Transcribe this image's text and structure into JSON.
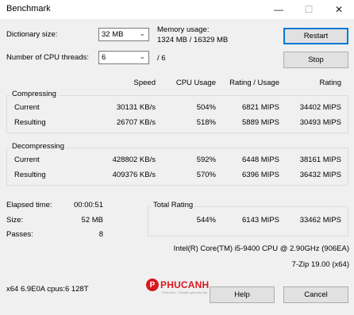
{
  "window": {
    "title": "Benchmark",
    "min": "—",
    "max": "☐",
    "close": "✕"
  },
  "dictionary": {
    "label": "Dictionary size:",
    "value": "32 MB"
  },
  "memory": {
    "label": "Memory usage:",
    "value": "1324 MB / 16329 MB"
  },
  "threads": {
    "label": "Number of CPU threads:",
    "value": "6",
    "max": "/ 6"
  },
  "buttons": {
    "restart": "Restart",
    "stop": "Stop",
    "help": "Help",
    "cancel": "Cancel"
  },
  "headers": {
    "speed": "Speed",
    "cpu_usage": "CPU Usage",
    "rating_usage": "Rating / Usage",
    "rating": "Rating"
  },
  "compressing": {
    "label": "Compressing",
    "current": {
      "label": "Current",
      "speed": "30131 KB/s",
      "cpu": "504%",
      "rating_usage": "6821 MIPS",
      "rating": "34402 MIPS"
    },
    "resulting": {
      "label": "Resulting",
      "speed": "26707 KB/s",
      "cpu": "518%",
      "rating_usage": "5889 MIPS",
      "rating": "30493 MIPS"
    }
  },
  "decompressing": {
    "label": "Decompressing",
    "current": {
      "label": "Current",
      "speed": "428802 KB/s",
      "cpu": "592%",
      "rating_usage": "6448 MIPS",
      "rating": "38161 MIPS"
    },
    "resulting": {
      "label": "Resulting",
      "speed": "409376 KB/s",
      "cpu": "570%",
      "rating_usage": "6396 MIPS",
      "rating": "36432 MIPS"
    }
  },
  "stats": {
    "elapsed_label": "Elapsed time:",
    "elapsed": "00:00:51",
    "size_label": "Size:",
    "size": "52 MB",
    "passes_label": "Passes:",
    "passes": "8"
  },
  "total": {
    "label": "Total Rating",
    "cpu": "544%",
    "rating_usage": "6143 MIPS",
    "rating": "33462 MIPS"
  },
  "cpu_info": "Intel(R) Core(TM) i5-9400 CPU @ 2.90GHz (906EA)",
  "version": "7-Zip 19.00 (x64)",
  "sys_info": "x64 6.9E0A cpus:6 128T",
  "watermark": {
    "initial": "P",
    "name": "PHUCANH",
    "tagline": "Phúc Anh - Chuyên gia máy tính"
  },
  "colors": {
    "accent": "#0078d7",
    "brand": "#d71920"
  }
}
